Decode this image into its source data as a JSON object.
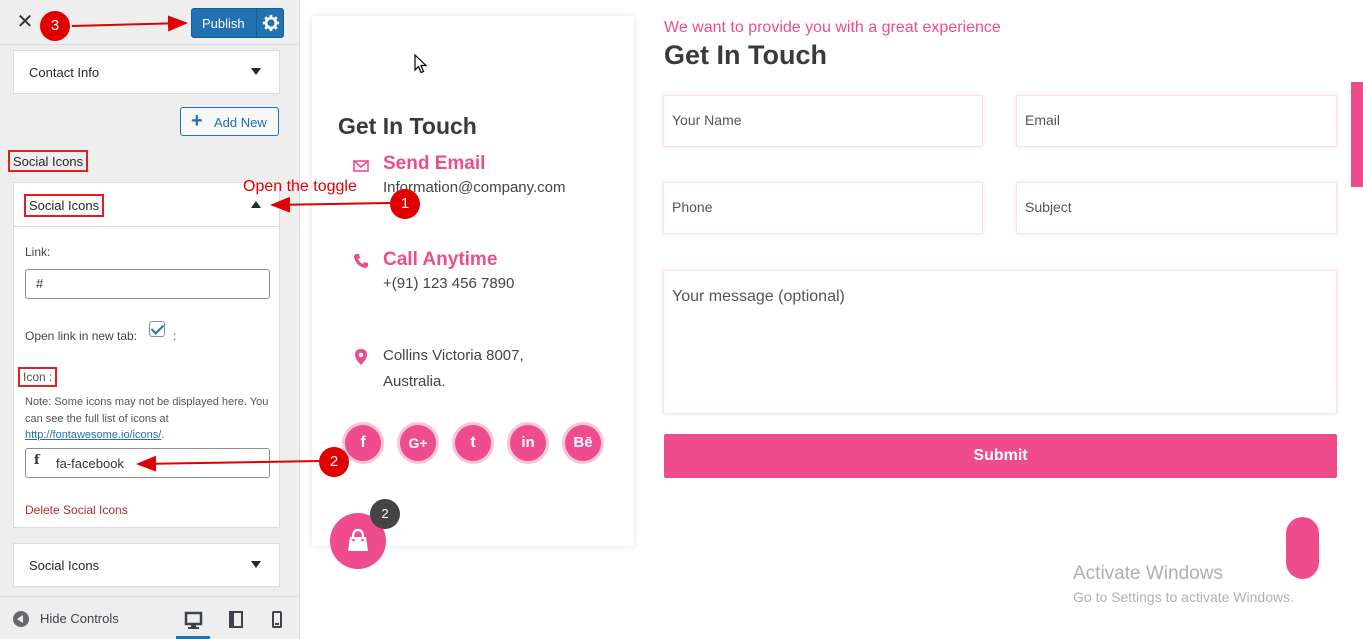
{
  "topbar": {
    "close": "✕",
    "publish_label": "Publish"
  },
  "sections": {
    "contact_info": "Contact Info",
    "add_new": "Add New",
    "social_heading": "Social Icons",
    "social_collapsed": "Social Icons"
  },
  "panel": {
    "title": "Social Icons",
    "link_label": "Link:",
    "link_value": "#",
    "newtab_label": "Open link in new tab:",
    "newtab_colon": ":",
    "newtab_checked": true,
    "icon_label": "Icon :",
    "note_prefix": "Note: Some icons may not be displayed here. You can see the full list of icons at",
    "note_link": "http://fontawesome.io/icons/",
    "note_suffix": ".",
    "icon_value": "fa-facebook",
    "icon_glyph": "f",
    "delete": "Delete Social Icons"
  },
  "bottombar": {
    "hide_controls": "Hide Controls"
  },
  "annotations": {
    "step1": "1",
    "step2": "2",
    "step3": "3",
    "open_toggle": "Open the toggle"
  },
  "preview": {
    "card_title": "Get In Touch",
    "email_head": "Send Email",
    "email_text": "Information@company.com",
    "call_head": "Call Anytime",
    "call_text": "+(91) 123 456 7890",
    "address_line1": "Collins Victoria 8007,",
    "address_line2": "Australia.",
    "social": [
      "f",
      "G+",
      "t",
      "in",
      "Bē"
    ],
    "cart_count": "2",
    "form_tag": "We want to provide you with a great experience",
    "form_title": "Get In Touch",
    "fields": {
      "name": "Your Name",
      "email": "Email",
      "phone": "Phone",
      "subject": "Subject",
      "message": "Your message (optional)"
    },
    "submit": "Submit",
    "activate_title": "Activate Windows",
    "activate_sub": "Go to Settings to activate Windows."
  },
  "colors": {
    "accent": "#ef4c8e",
    "wp_blue": "#2271b1",
    "annotation_red": "#e00000"
  }
}
